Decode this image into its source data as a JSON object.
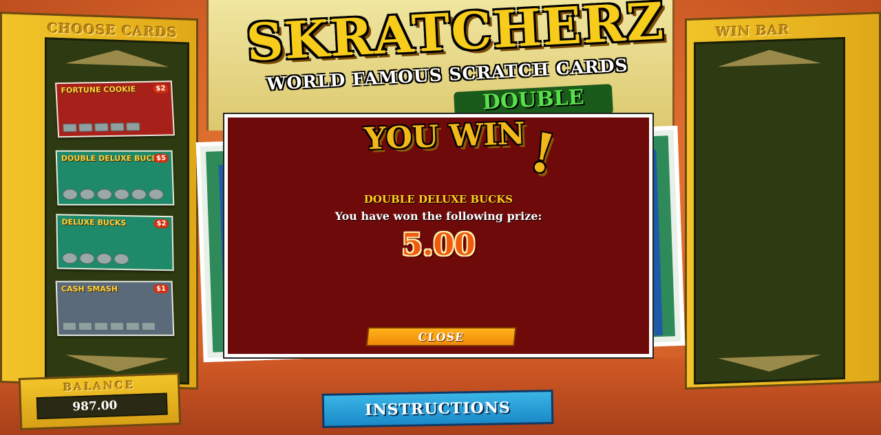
{
  "left_panel": {
    "title": "CHOOSE CARDS"
  },
  "right_panel": {
    "title": "WIN BAR"
  },
  "logo": {
    "title": "SKRATCHERZ",
    "subtitle": "WORLD FAMOUS SCRATCH CARDS",
    "tag": "DOUBLE"
  },
  "cards": [
    {
      "name": "FORTUNE COOKIE",
      "price": "$2"
    },
    {
      "name": "DOUBLE DELUXE BUCKS",
      "price": "$5"
    },
    {
      "name": "DELUXE BUCKS",
      "price": "$2"
    },
    {
      "name": "CASH SMASH",
      "price": "$1"
    }
  ],
  "dialog": {
    "title": "YOU WIN",
    "bang": "!",
    "game_name": "DOUBLE DELUXE BUCKS",
    "message": "You have won the following prize:",
    "amount": "5.00",
    "close_label": "CLOSE"
  },
  "balance": {
    "label": "BALANCE",
    "value": "987.00"
  },
  "instructions_label": "INSTRUCTIONS",
  "colors": {
    "dialog_bg": "#6e0a0a",
    "gold": "#f2b81a",
    "prize": "#f05a10",
    "button_blue": "#1a8ac8",
    "close_orange": "#f08a08"
  }
}
